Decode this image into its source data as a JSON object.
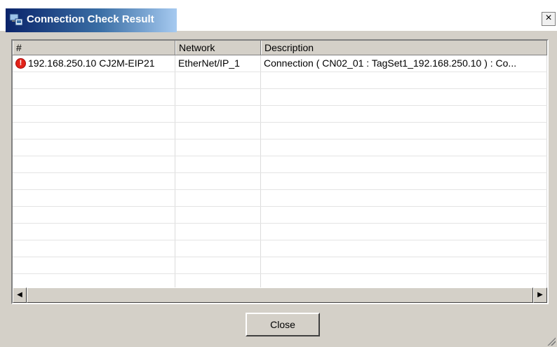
{
  "window": {
    "title": "Connection Check Result",
    "close_glyph": "×"
  },
  "table": {
    "columns": [
      "#",
      "Network",
      "Description"
    ],
    "rows": [
      {
        "status_icon": "error-icon",
        "device": "192.168.250.10 CJ2M-EIP21",
        "network": "EtherNet/IP_1",
        "description": "Connection ( CN02_01 : TagSet1_192.168.250.10 ) : Co..."
      }
    ],
    "empty_row_count": 13
  },
  "scrollbar": {
    "left_arrow": "◀",
    "right_arrow": "▶"
  },
  "buttons": {
    "close_label": "Close"
  },
  "colors": {
    "error": "#e2231a",
    "title_gradient_start": "#0a246a",
    "face": "#d4d0c8"
  }
}
